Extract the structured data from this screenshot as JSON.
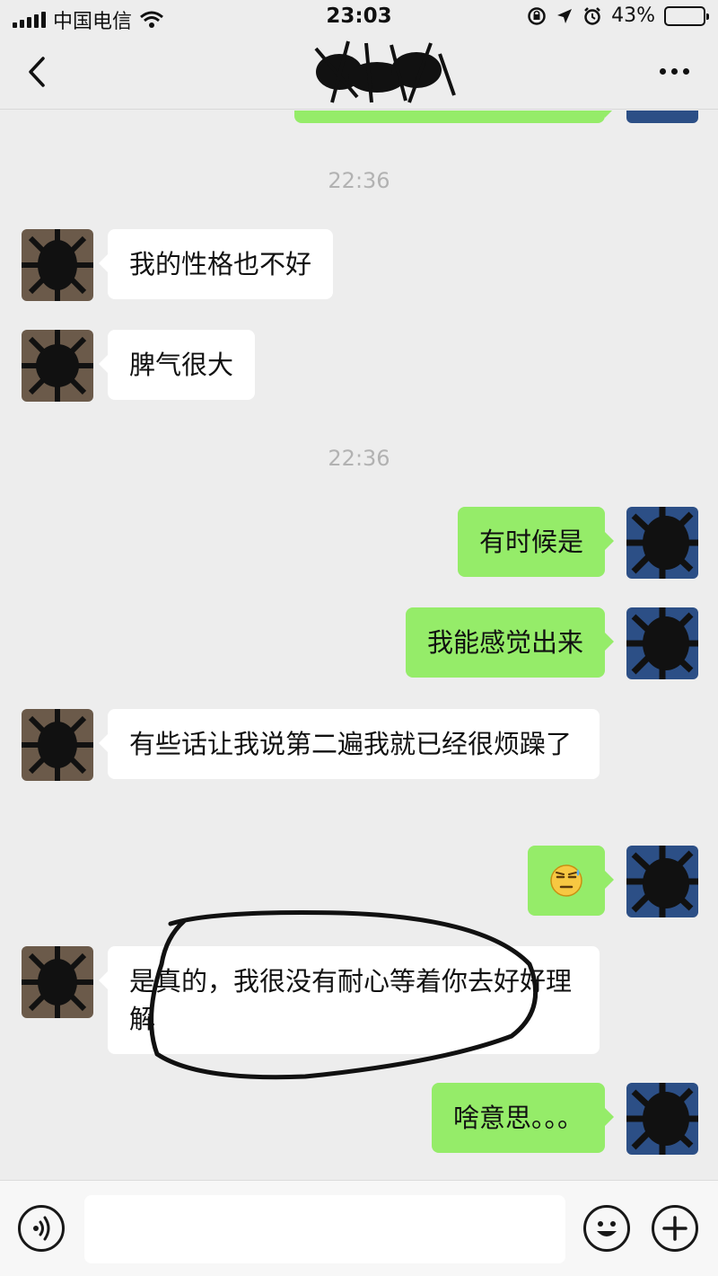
{
  "status_bar": {
    "carrier": "中国电信",
    "time": "23:03",
    "battery_percent": "43%",
    "battery_level": 0.43
  },
  "nav": {
    "back_icon": "chevron-left-icon",
    "more_icon": "more-horizontal-icon"
  },
  "chat": {
    "timestamps": [
      "22:36",
      "22:36"
    ],
    "messages": [
      {
        "from": "other",
        "text": "我的性格也不好"
      },
      {
        "from": "other",
        "text": "脾气很大"
      },
      {
        "from": "self",
        "text": "有时候是"
      },
      {
        "from": "self",
        "text": "我能感觉出来"
      },
      {
        "from": "other",
        "text": "有些话让我说第二遍我就已经很烦躁了"
      },
      {
        "from": "self",
        "text": "",
        "emoji": "sweat-emoji"
      },
      {
        "from": "other",
        "text": "是真的，我很没有耐心等着你去好好理解"
      },
      {
        "from": "self",
        "text": "啥意思。。。"
      }
    ]
  },
  "input_bar": {
    "voice_icon": "voice-icon",
    "emoji_icon": "emoji-icon",
    "plus_icon": "plus-icon",
    "draft": ""
  },
  "colors": {
    "background": "#ededed",
    "incoming_bubble": "#ffffff",
    "outgoing_bubble": "#95ec69",
    "timestamp": "#b2b2b2"
  }
}
